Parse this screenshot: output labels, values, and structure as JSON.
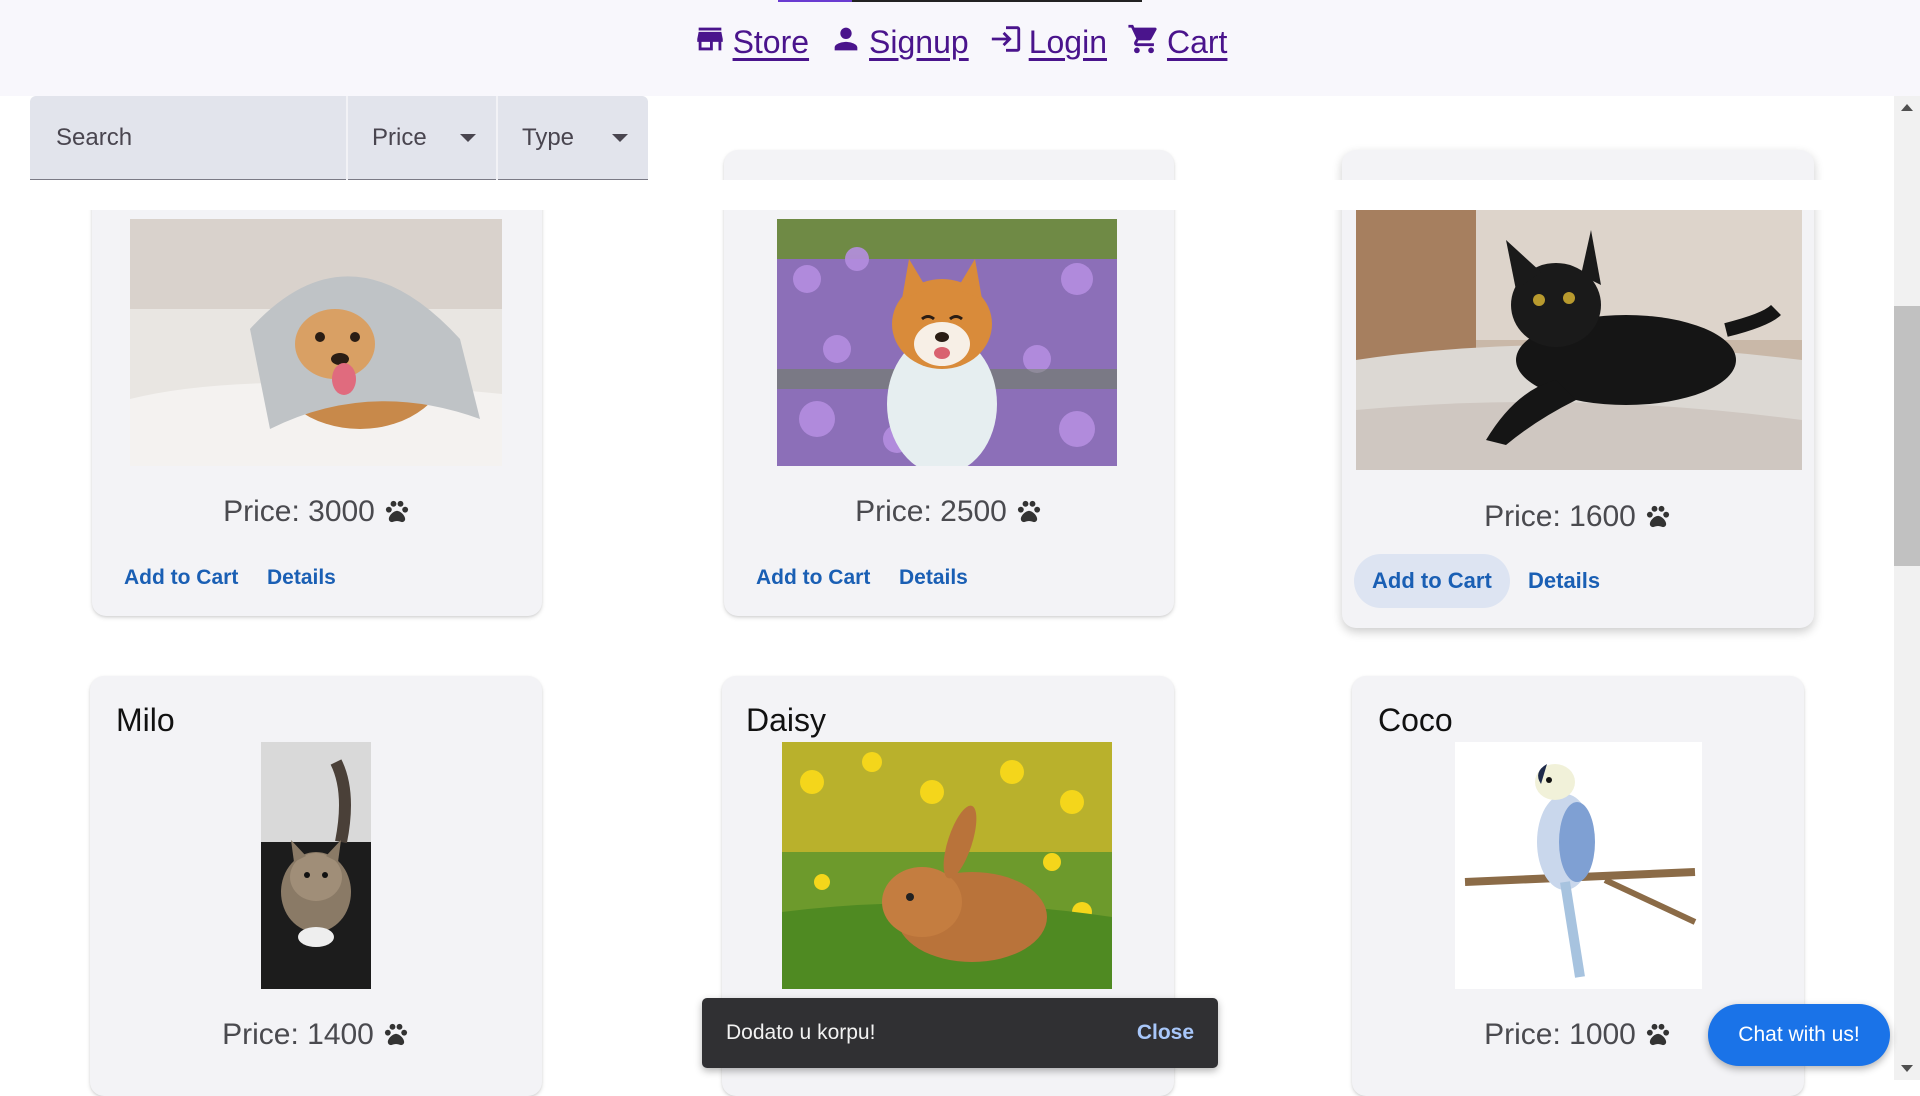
{
  "nav": {
    "store": "Store",
    "signup": "Signup",
    "login": "Login",
    "cart": "Cart"
  },
  "filters": {
    "search_placeholder": "Search",
    "price_label": "Price",
    "type_label": "Type"
  },
  "cards": [
    {
      "name": "",
      "photo": "golden retriever under blanket",
      "price": "Price: 3000",
      "add": "Add to Cart",
      "details": "Details"
    },
    {
      "name": "",
      "photo": "shiba inu in purple flowers",
      "price": "Price: 2500",
      "add": "Add to Cart",
      "details": "Details"
    },
    {
      "name": "",
      "photo": "black cat on bed",
      "price": "Price: 1600",
      "add": "Add to Cart",
      "details": "Details"
    },
    {
      "name": "Milo",
      "photo": "tabby cat",
      "price": "Price: 1400"
    },
    {
      "name": "Daisy",
      "photo": "brown rabbit in grass",
      "price": ""
    },
    {
      "name": "Coco",
      "photo": "budgie on branch",
      "price": "Price: 1000"
    }
  ],
  "snackbar": {
    "message": "Dodato u korpu!",
    "close": "Close"
  },
  "chat": {
    "label": "Chat with us!"
  },
  "colors": {
    "nav_link": "#4a148c",
    "action_button": "#1a5fb4",
    "chat_button": "#1a73e8",
    "card_bg": "#f3f3f6"
  }
}
